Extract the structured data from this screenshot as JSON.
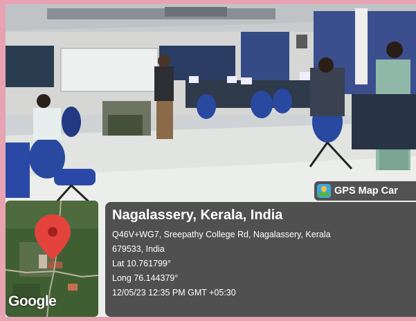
{
  "photo": {
    "description_icon": "computer-lab-photo"
  },
  "badge": {
    "icon": "gps-map-camera-icon",
    "label": "GPS Map Car"
  },
  "map": {
    "watermark": "Google",
    "pin_icon": "map-pin-icon",
    "pin_color": "#e4433c"
  },
  "info": {
    "place": "Nagalassery, Kerala, India",
    "address_line1": "Q46V+WG7, Sreepathy College Rd, Nagalassery, Kerala",
    "address_line2": "679533, India",
    "lat": "Lat 10.761799°",
    "long": "Long 76.144379°",
    "datetime": "12/05/23 12:35 PM GMT +05:30"
  }
}
